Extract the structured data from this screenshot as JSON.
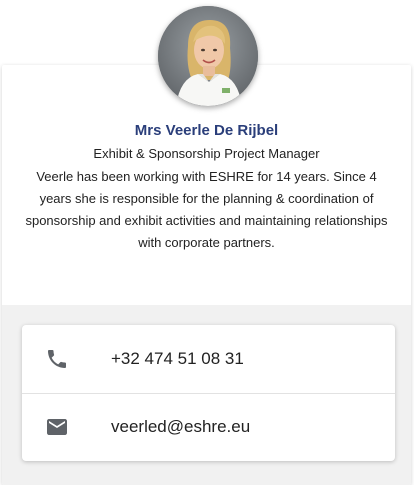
{
  "profile": {
    "name": "Mrs Veerle De Rijbel",
    "title": "Exhibit & Sponsorship Project Manager",
    "bio": "Veerle has been working with ESHRE for 14 years. Since 4 years she is responsible for the planning & coordination of sponsorship and exhibit activities and maintaining relationships with corporate partners."
  },
  "contact": {
    "phone": {
      "icon": "phone-icon",
      "value": "+32 474 51 08 31"
    },
    "email": {
      "icon": "email-icon",
      "value": "veerled@eshre.eu"
    }
  },
  "colors": {
    "name": "#2a3e7a",
    "icon": "#5f6368",
    "contact_background": "#f1f1f1"
  }
}
